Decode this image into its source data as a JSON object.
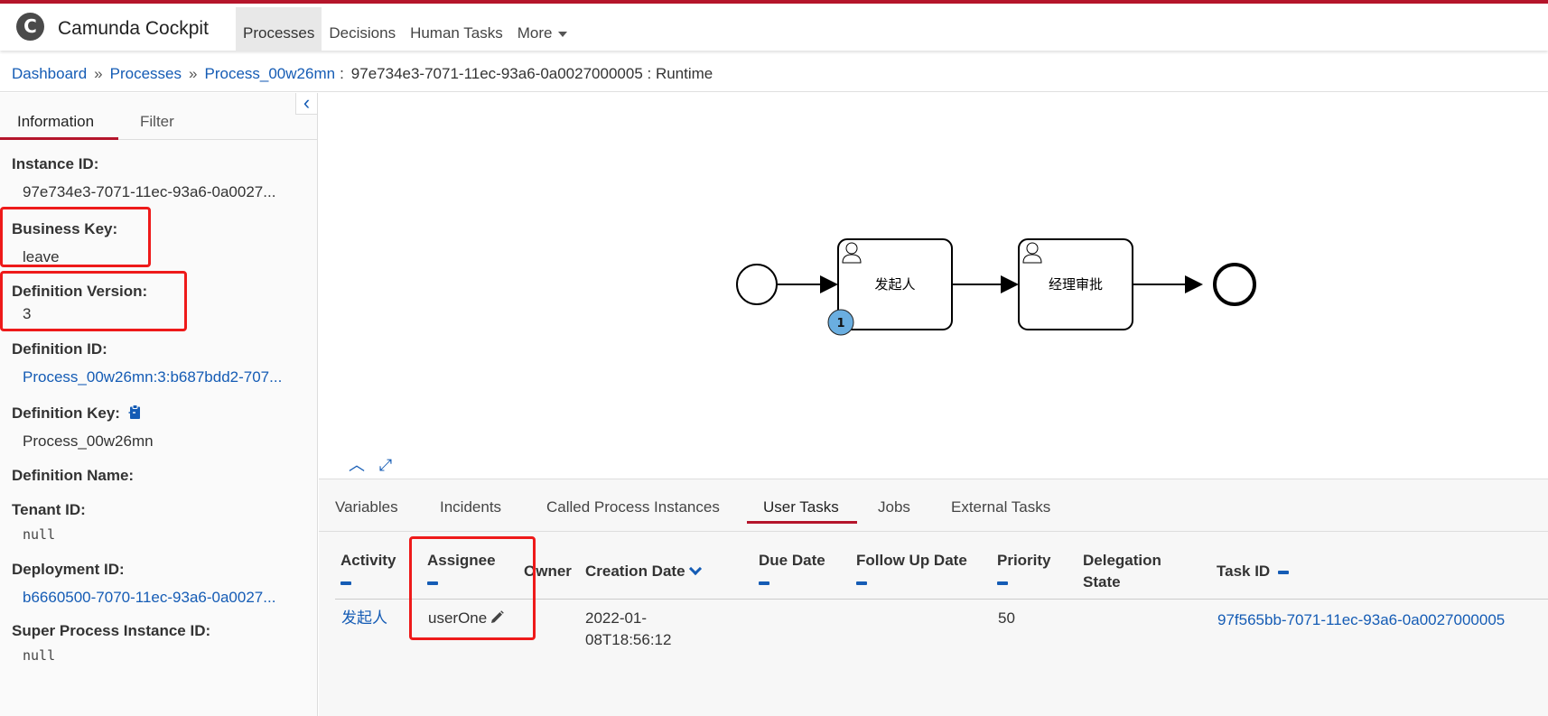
{
  "app": {
    "brand": "Camunda Cockpit",
    "logo_letter": "C",
    "nav": [
      {
        "label": "Processes"
      },
      {
        "label": "Decisions"
      },
      {
        "label": "Human Tasks"
      },
      {
        "label": "More"
      }
    ]
  },
  "breadcrumb": {
    "dashboard": "Dashboard",
    "processes": "Processes",
    "process": "Process_00w26mn",
    "separator": "»",
    "colon": ":",
    "current": "97e734e3-7071-11ec-93a6-0a0027000005 : Runtime"
  },
  "sidebar": {
    "tabs": [
      "Information",
      "Filter"
    ],
    "instance_id_label": "Instance ID:",
    "instance_id": "97e734e3-7071-11ec-93a6-0a0027...",
    "business_key_label": "Business Key:",
    "business_key": "leave",
    "definition_version_label": "Definition Version:",
    "definition_version": "3",
    "definition_id_label": "Definition ID:",
    "definition_id": "Process_00w26mn:3:b687bdd2-707...",
    "definition_key_label": "Definition Key:",
    "definition_key": "Process_00w26mn",
    "definition_name_label": "Definition Name:",
    "tenant_id_label": "Tenant ID:",
    "tenant_id": "null",
    "deployment_id_label": "Deployment ID:",
    "deployment_id": "b6660500-7070-11ec-93a6-0a0027...",
    "super_process_label": "Super Process Instance ID:",
    "super_process": "null"
  },
  "diagram": {
    "task1": "发起人",
    "task2": "经理审批",
    "token_count": "1",
    "colors": {
      "token": "#6aaee0",
      "stroke": "#000000"
    }
  },
  "bottom": {
    "tabs": [
      "Variables",
      "Incidents",
      "Called Process Instances",
      "User Tasks",
      "Jobs",
      "External Tasks"
    ],
    "active_tab": "User Tasks",
    "columns": {
      "activity": "Activity",
      "assignee": "Assignee",
      "owner": "Owner",
      "creation_date": "Creation Date",
      "due_date": "Due Date",
      "follow_up": "Follow Up Date",
      "priority": "Priority",
      "delegation_1": "Delegation",
      "delegation_2": "State",
      "task_id": "Task ID"
    },
    "rows": [
      {
        "activity": "发起人",
        "assignee": "userOne",
        "owner": "",
        "creation_date_1": "2022-01-",
        "creation_date_2": "08T18:56:12",
        "due_date": "",
        "follow_up": "",
        "priority": "50",
        "delegation_state": "",
        "task_id": "97f565bb-7071-11ec-93a6-0a0027000005"
      }
    ]
  },
  "colors": {
    "accent": "#b5152b",
    "link": "#155cb5",
    "highlight": "#ee1a1a"
  }
}
